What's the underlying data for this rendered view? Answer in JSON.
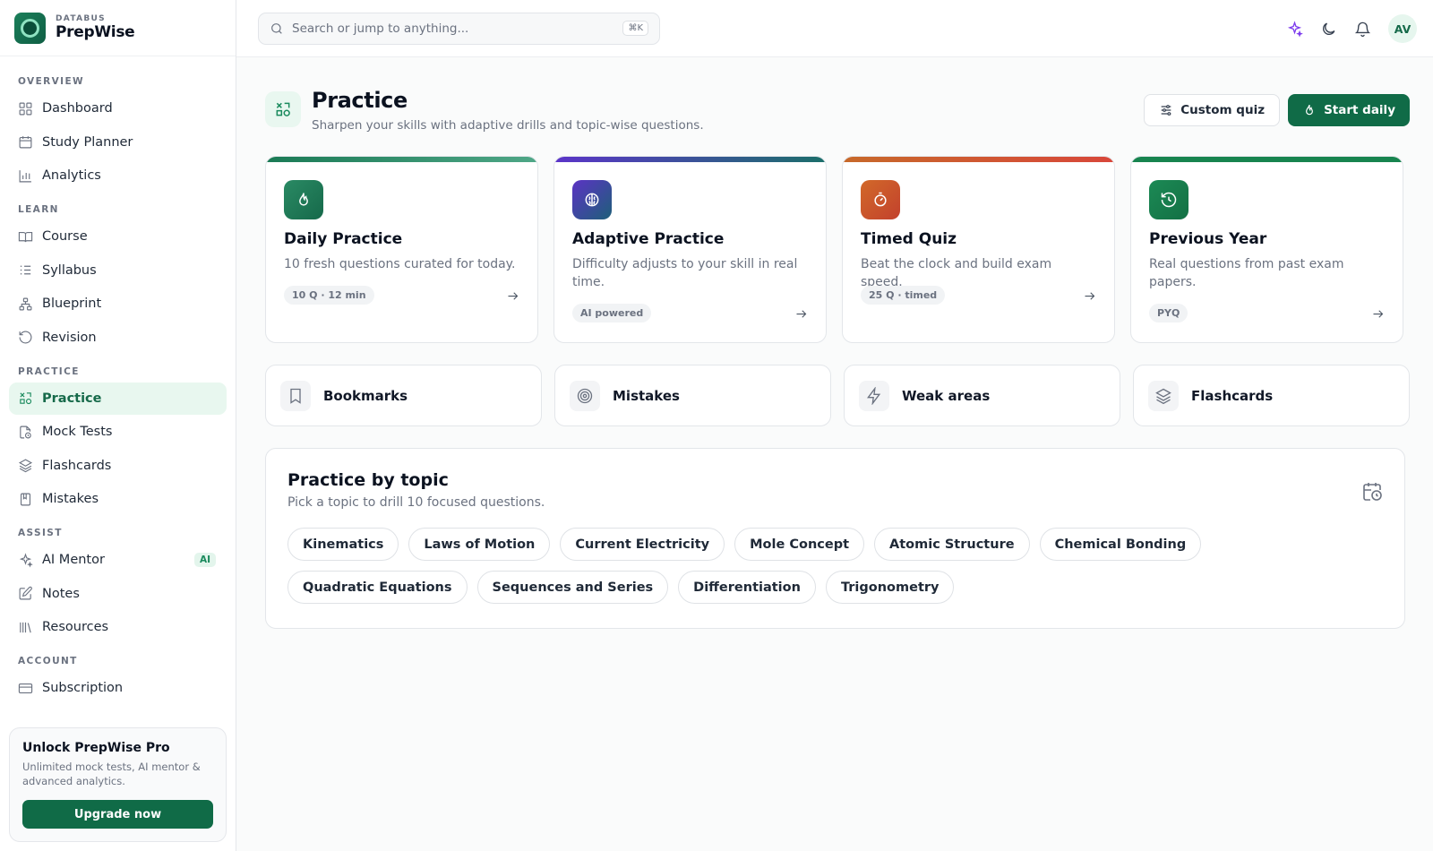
{
  "brand": {
    "org": "DATABUS",
    "name": "PrepWise"
  },
  "sidebar": {
    "sections": [
      {
        "label": "OVERVIEW",
        "items": [
          {
            "label": "Dashboard"
          },
          {
            "label": "Study Planner"
          },
          {
            "label": "Analytics"
          }
        ]
      },
      {
        "label": "LEARN",
        "items": [
          {
            "label": "Course"
          },
          {
            "label": "Syllabus"
          },
          {
            "label": "Blueprint"
          },
          {
            "label": "Revision"
          }
        ]
      },
      {
        "label": "PRACTICE",
        "items": [
          {
            "label": "Practice",
            "active": true
          },
          {
            "label": "Mock Tests"
          },
          {
            "label": "Flashcards"
          },
          {
            "label": "Mistakes"
          }
        ]
      },
      {
        "label": "ASSIST",
        "items": [
          {
            "label": "AI Mentor",
            "badge": "AI"
          },
          {
            "label": "Notes"
          },
          {
            "label": "Resources"
          }
        ]
      },
      {
        "label": "ACCOUNT",
        "items": [
          {
            "label": "Subscription"
          }
        ]
      }
    ],
    "upgrade": {
      "title": "Unlock PrepWise Pro",
      "desc": "Unlimited mock tests, AI mentor & advanced analytics.",
      "button": "Upgrade now"
    }
  },
  "topbar": {
    "search_placeholder": "Search or jump to anything...",
    "shortcut": "⌘K",
    "avatar": "AV"
  },
  "header": {
    "title": "Practice",
    "subtitle": "Sharpen your skills with adaptive drills and topic-wise questions.",
    "custom_quiz": "Custom quiz",
    "start_daily": "Start daily"
  },
  "cards": [
    {
      "title": "Daily Practice",
      "desc": "10 fresh questions curated for today.",
      "pill": "10 Q · 12 min",
      "icon": "flame-icon",
      "color": "#1f7a57",
      "bar": "linear-gradient(90deg,#1a7a55,#4fa787)"
    },
    {
      "title": "Adaptive Practice",
      "desc": "Difficulty adjusts to your skill in real time.",
      "pill": "AI powered",
      "icon": "brain-icon",
      "color": "#3b3aa0",
      "bar": "linear-gradient(90deg,#5b34c9,#1b6f6a)"
    },
    {
      "title": "Timed Quiz",
      "desc": "Beat the clock and build exam speed.",
      "pill": "25 Q · timed",
      "icon": "timer-icon",
      "color": "#c7522a",
      "bar": "linear-gradient(90deg,#c7692a,#d8473a)"
    },
    {
      "title": "Previous Year",
      "desc": "Real questions from past exam papers.",
      "pill": "PYQ",
      "icon": "history-icon",
      "color": "#16804f",
      "bar": "#17844f"
    }
  ],
  "quick": [
    {
      "label": "Bookmarks",
      "icon": "bookmark-icon"
    },
    {
      "label": "Mistakes",
      "icon": "target-icon"
    },
    {
      "label": "Weak areas",
      "icon": "bolt-icon"
    },
    {
      "label": "Flashcards",
      "icon": "layers-icon"
    }
  ],
  "topics": {
    "title": "Practice by topic",
    "subtitle": "Pick a topic to drill 10 focused questions.",
    "chips": [
      "Kinematics",
      "Laws of Motion",
      "Current Electricity",
      "Mole Concept",
      "Atomic Structure",
      "Chemical Bonding",
      "Quadratic Equations",
      "Sequences and Series",
      "Differentiation",
      "Trigonometry"
    ]
  }
}
